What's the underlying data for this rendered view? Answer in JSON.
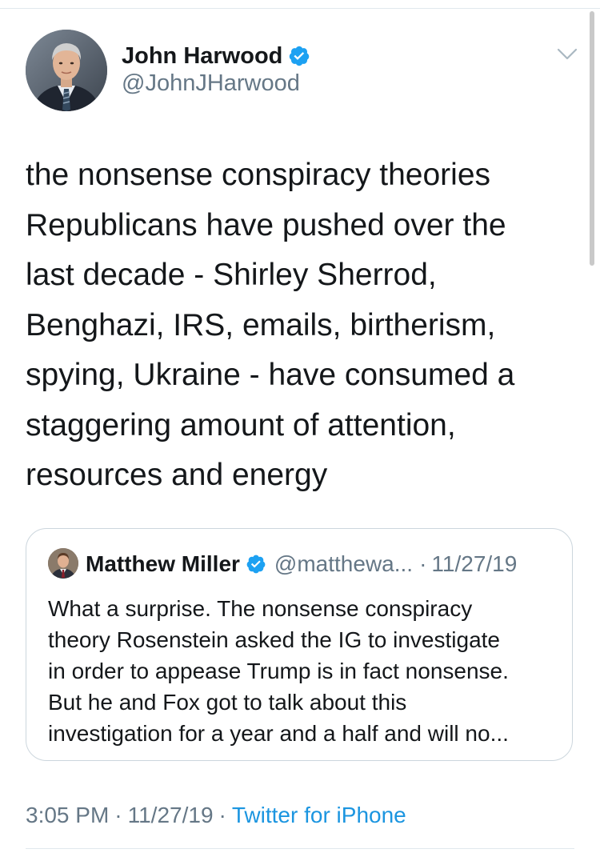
{
  "tweet": {
    "author": {
      "name": "John Harwood",
      "handle": "@JohnJHarwood",
      "verified": true,
      "avatar_icon": "author-avatar-photo"
    },
    "menu_icon": "chevron-down-icon",
    "text": "the nonsense conspiracy theories\nRepublicans have pushed over the\nlast decade - Shirley Sherrod,\nBenghazi, IRS, emails, birtherism,\nspying, Ukraine - have consumed a\nstaggering amount of attention,\nresources and energy",
    "quoted": {
      "name": "Matthew Miller",
      "handle": "@matthewa...",
      "separator": "·",
      "date": "11/27/19",
      "verified": true,
      "text": "What a surprise. The nonsense conspiracy\ntheory Rosenstein asked the IG to investigate\nin order to appease Trump is in fact nonsense.\nBut he and Fox got to talk about this\ninvestigation for a year and a half and will no..."
    },
    "meta": {
      "time": "3:05 PM",
      "separator": "·",
      "date": "11/27/19",
      "source": "Twitter for iPhone"
    }
  },
  "colors": {
    "text_primary": "#14171a",
    "text_secondary": "#657786",
    "link": "#1b95e0",
    "verified_badge": "#1da1f2",
    "border": "#ccd6dd"
  }
}
